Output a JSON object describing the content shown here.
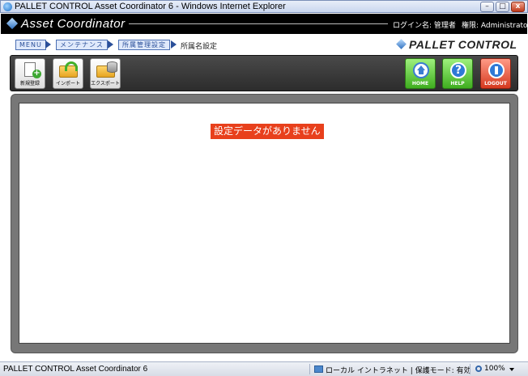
{
  "window": {
    "title": "PALLET CONTROL Asset Coordinator 6 - Windows Internet Explorer",
    "min_glyph": "–",
    "max_glyph": "□",
    "close_glyph": "x"
  },
  "header": {
    "app_name": "Asset Coordinator",
    "login": "ログイン名: 管理者",
    "role": "権限: Administrator"
  },
  "breadcrumb": {
    "items": [
      "MENU",
      "メンテナンス",
      "所属管理設定"
    ],
    "current": "所属名設定"
  },
  "brand": {
    "name": "PALLET CONTROL"
  },
  "toolbar": {
    "new_label": "新規登録",
    "import_label": "インポート",
    "export_label": "エクスポート",
    "home_label": "HOME",
    "help_label": "HELP",
    "logout_label": "LOGOUT",
    "help_glyph": "?"
  },
  "main": {
    "message": "設定データがありません"
  },
  "statusbar": {
    "text": "PALLET CONTROL Asset Coordinator 6",
    "zone": "ローカル イントラネット | 保護モード: 有効",
    "zoom": "100%"
  },
  "colors": {
    "header_bg": "#000000",
    "message_bg": "#e8401c",
    "panel_bg": "#777777",
    "crumb_accent": "#2a4f99"
  }
}
